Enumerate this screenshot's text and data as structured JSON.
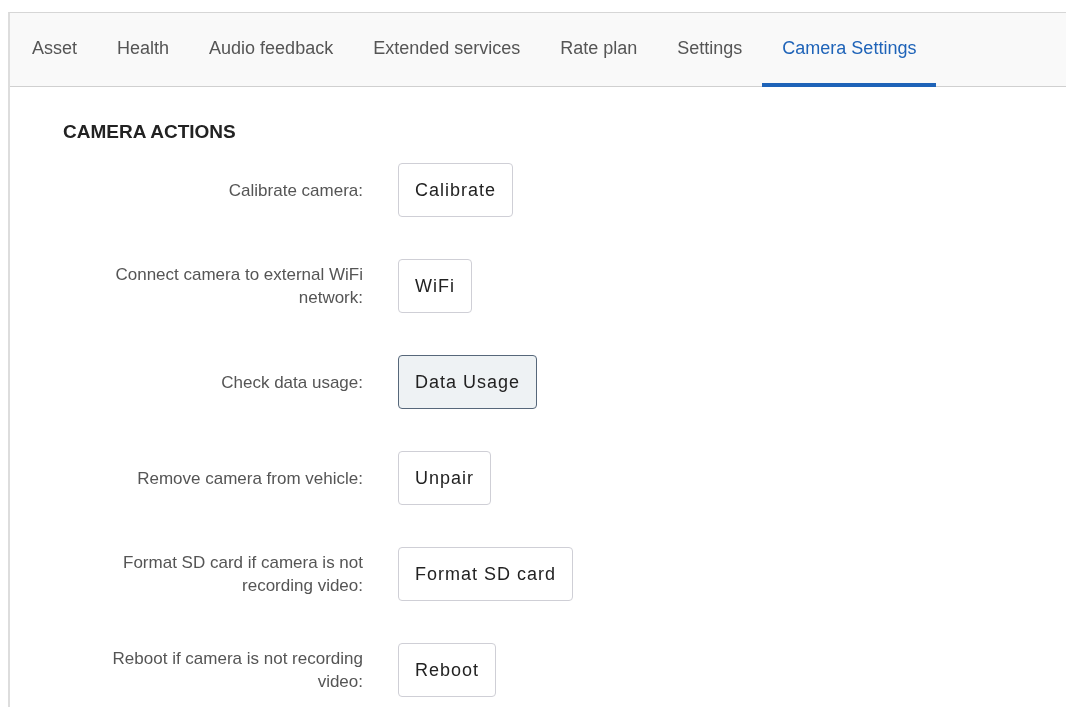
{
  "tabs": [
    {
      "label": "Asset",
      "selected": false
    },
    {
      "label": "Health",
      "selected": false
    },
    {
      "label": "Audio feedback",
      "selected": false
    },
    {
      "label": "Extended services",
      "selected": false
    },
    {
      "label": "Rate plan",
      "selected": false
    },
    {
      "label": "Settings",
      "selected": false
    },
    {
      "label": "Camera Settings",
      "selected": true
    }
  ],
  "section": {
    "heading": "CAMERA ACTIONS",
    "actions": [
      {
        "label": "Calibrate camera:",
        "button": "Calibrate",
        "highlighted": false
      },
      {
        "label": "Connect camera to external WiFi network:",
        "button": "WiFi",
        "highlighted": false
      },
      {
        "label": "Check data usage:",
        "button": "Data Usage",
        "highlighted": true
      },
      {
        "label": "Remove camera from vehicle:",
        "button": "Unpair",
        "highlighted": false
      },
      {
        "label": "Format SD card if camera is not recording video:",
        "button": "Format SD card",
        "highlighted": false
      },
      {
        "label": "Reboot if camera is not recording video:",
        "button": "Reboot",
        "highlighted": false
      }
    ]
  }
}
